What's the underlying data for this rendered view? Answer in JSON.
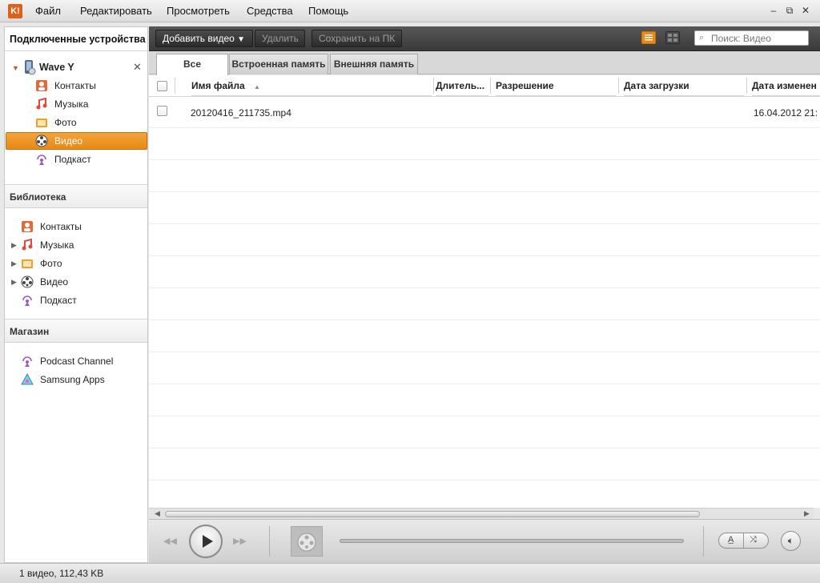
{
  "menubar": {
    "logo": "K!",
    "items": [
      "Файл",
      "Редактировать",
      "Просмотреть",
      "Средства",
      "Помощь"
    ],
    "window_buttons": {
      "minimize": "–",
      "restore": "⧉",
      "close": "✕"
    }
  },
  "sidebar": {
    "devices_header": "Подключенные устройства",
    "device": {
      "name": "Wave Y",
      "close": "✕"
    },
    "device_items": [
      {
        "label": "Контакты",
        "icon": "contacts-icon"
      },
      {
        "label": "Музыка",
        "icon": "music-icon"
      },
      {
        "label": "Фото",
        "icon": "photo-icon"
      },
      {
        "label": "Видео",
        "icon": "video-icon",
        "selected": true
      },
      {
        "label": "Подкаст",
        "icon": "podcast-icon"
      }
    ],
    "library_header": "Библиотека",
    "library_items": [
      {
        "label": "Контакты",
        "icon": "contacts-icon"
      },
      {
        "label": "Музыка",
        "icon": "music-icon"
      },
      {
        "label": "Фото",
        "icon": "photo-icon"
      },
      {
        "label": "Видео",
        "icon": "video-icon"
      },
      {
        "label": "Подкаст",
        "icon": "podcast-icon"
      }
    ],
    "store_header": "Магазин",
    "store_items": [
      {
        "label": "Podcast Channel",
        "icon": "podcast-icon"
      },
      {
        "label": "Samsung Apps",
        "icon": "samsung-apps-icon"
      }
    ]
  },
  "toolbar": {
    "add_video": "Добавить видео",
    "delete": "Удалить",
    "save_to_pc": "Сохранить на ПК",
    "search_placeholder": "Поиск: Видео"
  },
  "tabs": [
    "Все",
    "Встроенная память",
    "Внешняя память"
  ],
  "table": {
    "columns": [
      "Имя файла",
      "Длитель...",
      "Разрешение",
      "Дата загрузки",
      "Дата изменен"
    ],
    "rows": [
      {
        "filename": "20120416_211735.mp4",
        "duration": "",
        "resolution": "",
        "uploaded": "",
        "modified": "16.04.2012 21:"
      }
    ]
  },
  "statusbar": {
    "text": "1 видео, 112,43 KB"
  },
  "colors": {
    "accent_orange": "#e88a14",
    "toolbar_dark": "#3a3a3a"
  }
}
